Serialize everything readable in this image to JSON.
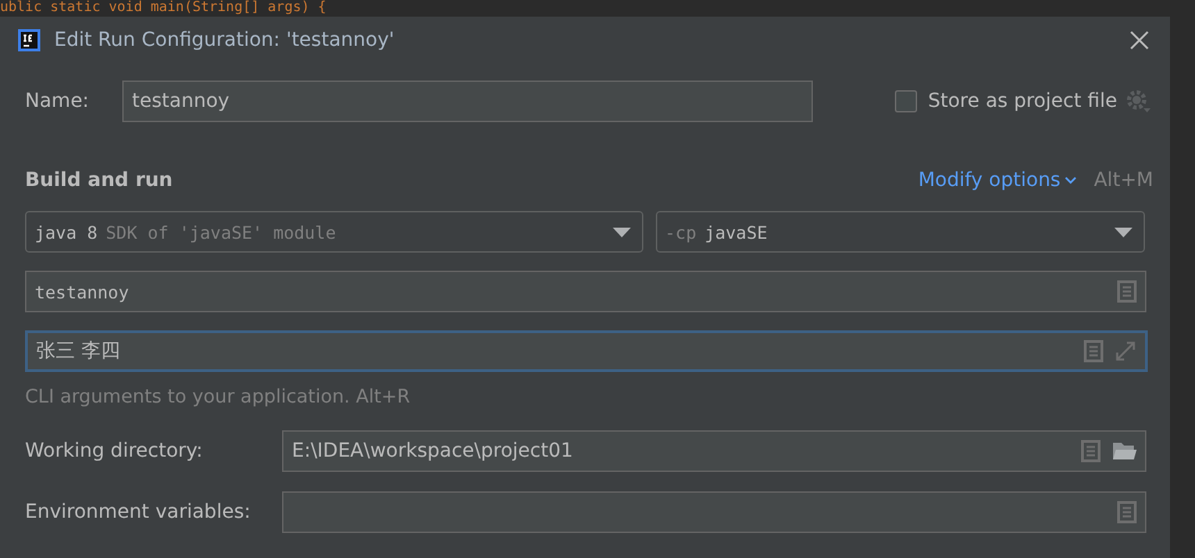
{
  "editor": {
    "code_line": "ublic static void main(String[] args) {"
  },
  "window": {
    "title": "Edit Run Configuration: 'testannoy'"
  },
  "name": {
    "label": "Name:",
    "value": "testannoy"
  },
  "store_as_project_file": {
    "label": "Store as project file",
    "checked": false
  },
  "section": {
    "title": "Build and run",
    "modify_options": "Modify options",
    "shortcut": "Alt+M"
  },
  "jre": {
    "value": "java 8",
    "hint": "SDK of 'javaSE' module"
  },
  "classpath": {
    "prefix": "-cp",
    "value": "javaSE"
  },
  "main_class": {
    "value": "testannoy"
  },
  "program_arguments": {
    "value": "张三 李四",
    "focused": true,
    "hint": "CLI arguments to your application. Alt+R"
  },
  "working_directory": {
    "label": "Working directory:",
    "value": "E:\\IDEA\\workspace\\project01"
  },
  "environment_variables": {
    "label": "Environment variables:"
  }
}
